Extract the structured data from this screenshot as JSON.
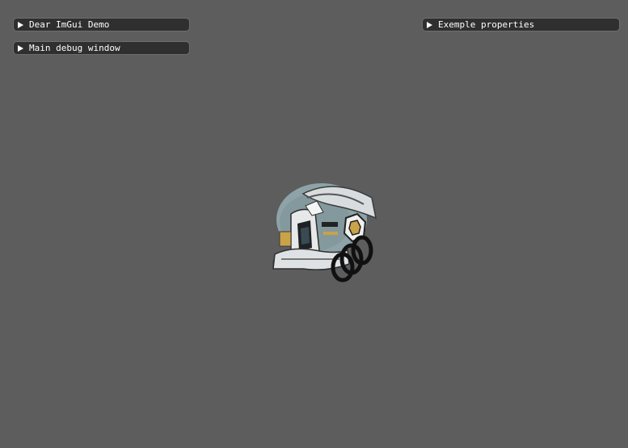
{
  "windows": {
    "demo": {
      "title": "Dear ImGui Demo",
      "collapsed": true
    },
    "debug": {
      "title": "Main debug window",
      "collapsed": true
    },
    "properties": {
      "title": "Exemple properties",
      "collapsed": true
    }
  },
  "scene": {
    "model": "helmet-model",
    "background_color": "#5d5d5d"
  }
}
